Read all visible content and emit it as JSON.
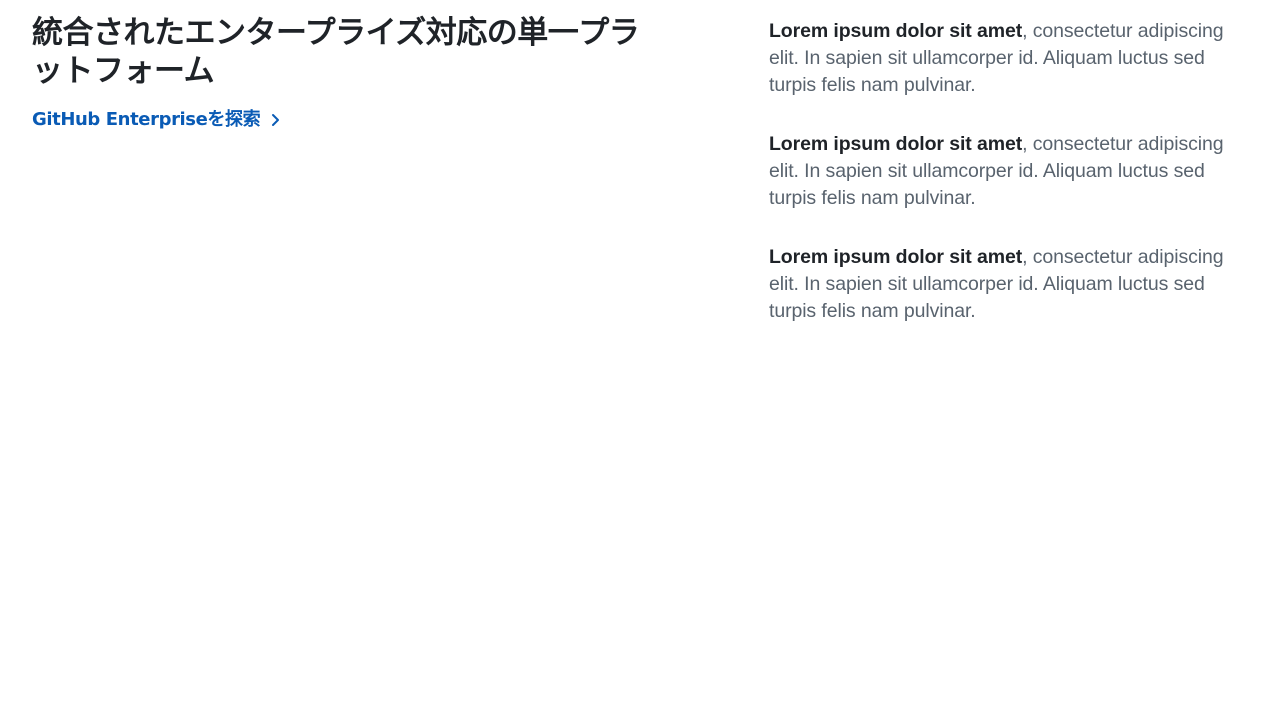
{
  "hero": {
    "headline": "統合されたエンタープライズ対応の単一プラットフォーム",
    "cta_label": "GitHub Enterpriseを探索",
    "cta_icon": "chevron-right-icon",
    "link_color": "#0a5bb5"
  },
  "features": [
    {
      "bold": "Lorem ipsum dolor sit amet",
      "text": ", consectetur adipiscing elit. In sapien sit ullamcorper id. Aliquam luctus sed turpis felis nam pulvinar."
    },
    {
      "bold": "Lorem ipsum dolor sit amet",
      "text": ", consectetur adipiscing elit. In sapien sit ullamcorper id. Aliquam luctus sed turpis felis nam pulvinar."
    },
    {
      "bold": "Lorem ipsum dolor sit amet",
      "text": ", consectetur adipiscing elit. In sapien sit ullamcorper id. Aliquam luctus sed turpis felis nam pulvinar."
    }
  ]
}
